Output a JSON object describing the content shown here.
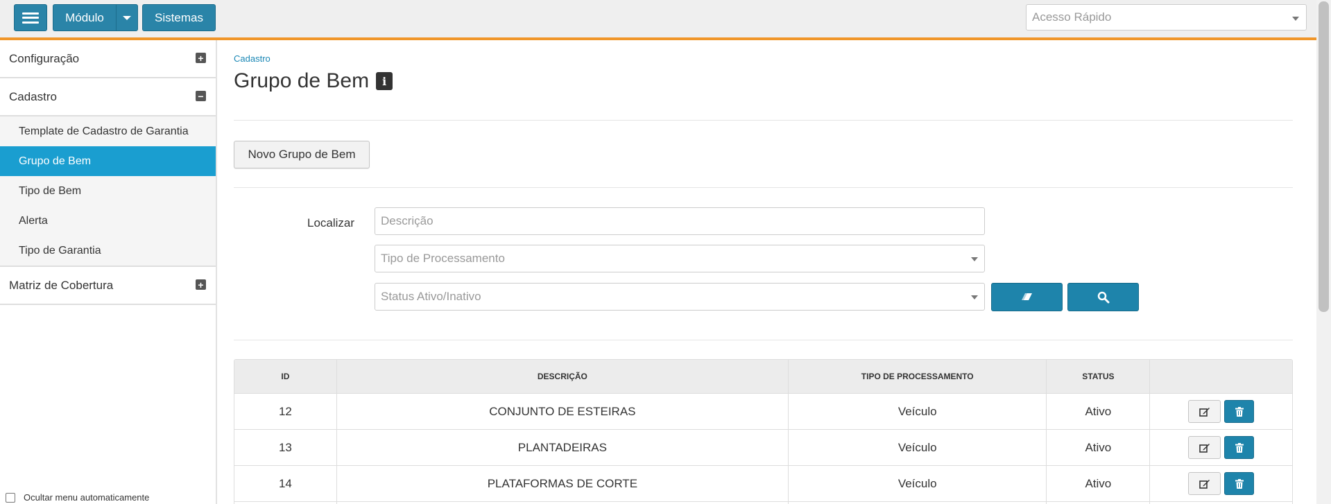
{
  "topbar": {
    "menu_icon": "hamburger-icon",
    "modulo_label": "Módulo",
    "sistemas_label": "Sistemas",
    "acesso_rapido_placeholder": "Acesso Rápido",
    "accent_color": "#f0962a",
    "brand_color": "#2a84a8"
  },
  "sidebar": {
    "groups": [
      {
        "label": "Configuração",
        "state": "+"
      },
      {
        "label": "Cadastro",
        "state": "−"
      },
      {
        "label": "Matriz de Cobertura",
        "state": "+"
      }
    ],
    "cadastro_items": [
      {
        "label": "Template de Cadastro de Garantia"
      },
      {
        "label": "Grupo de Bem",
        "active": true
      },
      {
        "label": "Tipo de Bem"
      },
      {
        "label": "Alerta"
      },
      {
        "label": "Tipo de Garantia"
      }
    ],
    "auto_hide_label": "Ocultar menu automaticamente",
    "active_color": "#1a9ed0"
  },
  "main": {
    "breadcrumb": "Cadastro",
    "title": "Grupo de Bem",
    "info_glyph": "i",
    "new_button": "Novo Grupo de Bem",
    "search": {
      "label": "Localizar",
      "descricao_placeholder": "Descrição",
      "tipo_placeholder": "Tipo de Processamento",
      "status_placeholder": "Status Ativo/Inativo",
      "clear_icon": "eraser-icon",
      "search_icon": "search-icon"
    },
    "table": {
      "headers": [
        "ID",
        "DESCRIÇÃO",
        "TIPO DE PROCESSAMENTO",
        "STATUS",
        ""
      ],
      "rows": [
        {
          "id": "12",
          "descricao": "CONJUNTO DE ESTEIRAS",
          "tipo": "Veículo",
          "status": "Ativo"
        },
        {
          "id": "13",
          "descricao": "PLANTADEIRAS",
          "tipo": "Veículo",
          "status": "Ativo"
        },
        {
          "id": "14",
          "descricao": "PLATAFORMAS DE CORTE",
          "tipo": "Veículo",
          "status": "Ativo"
        }
      ],
      "edit_icon": "edit-icon",
      "delete_icon": "trash-icon"
    }
  }
}
